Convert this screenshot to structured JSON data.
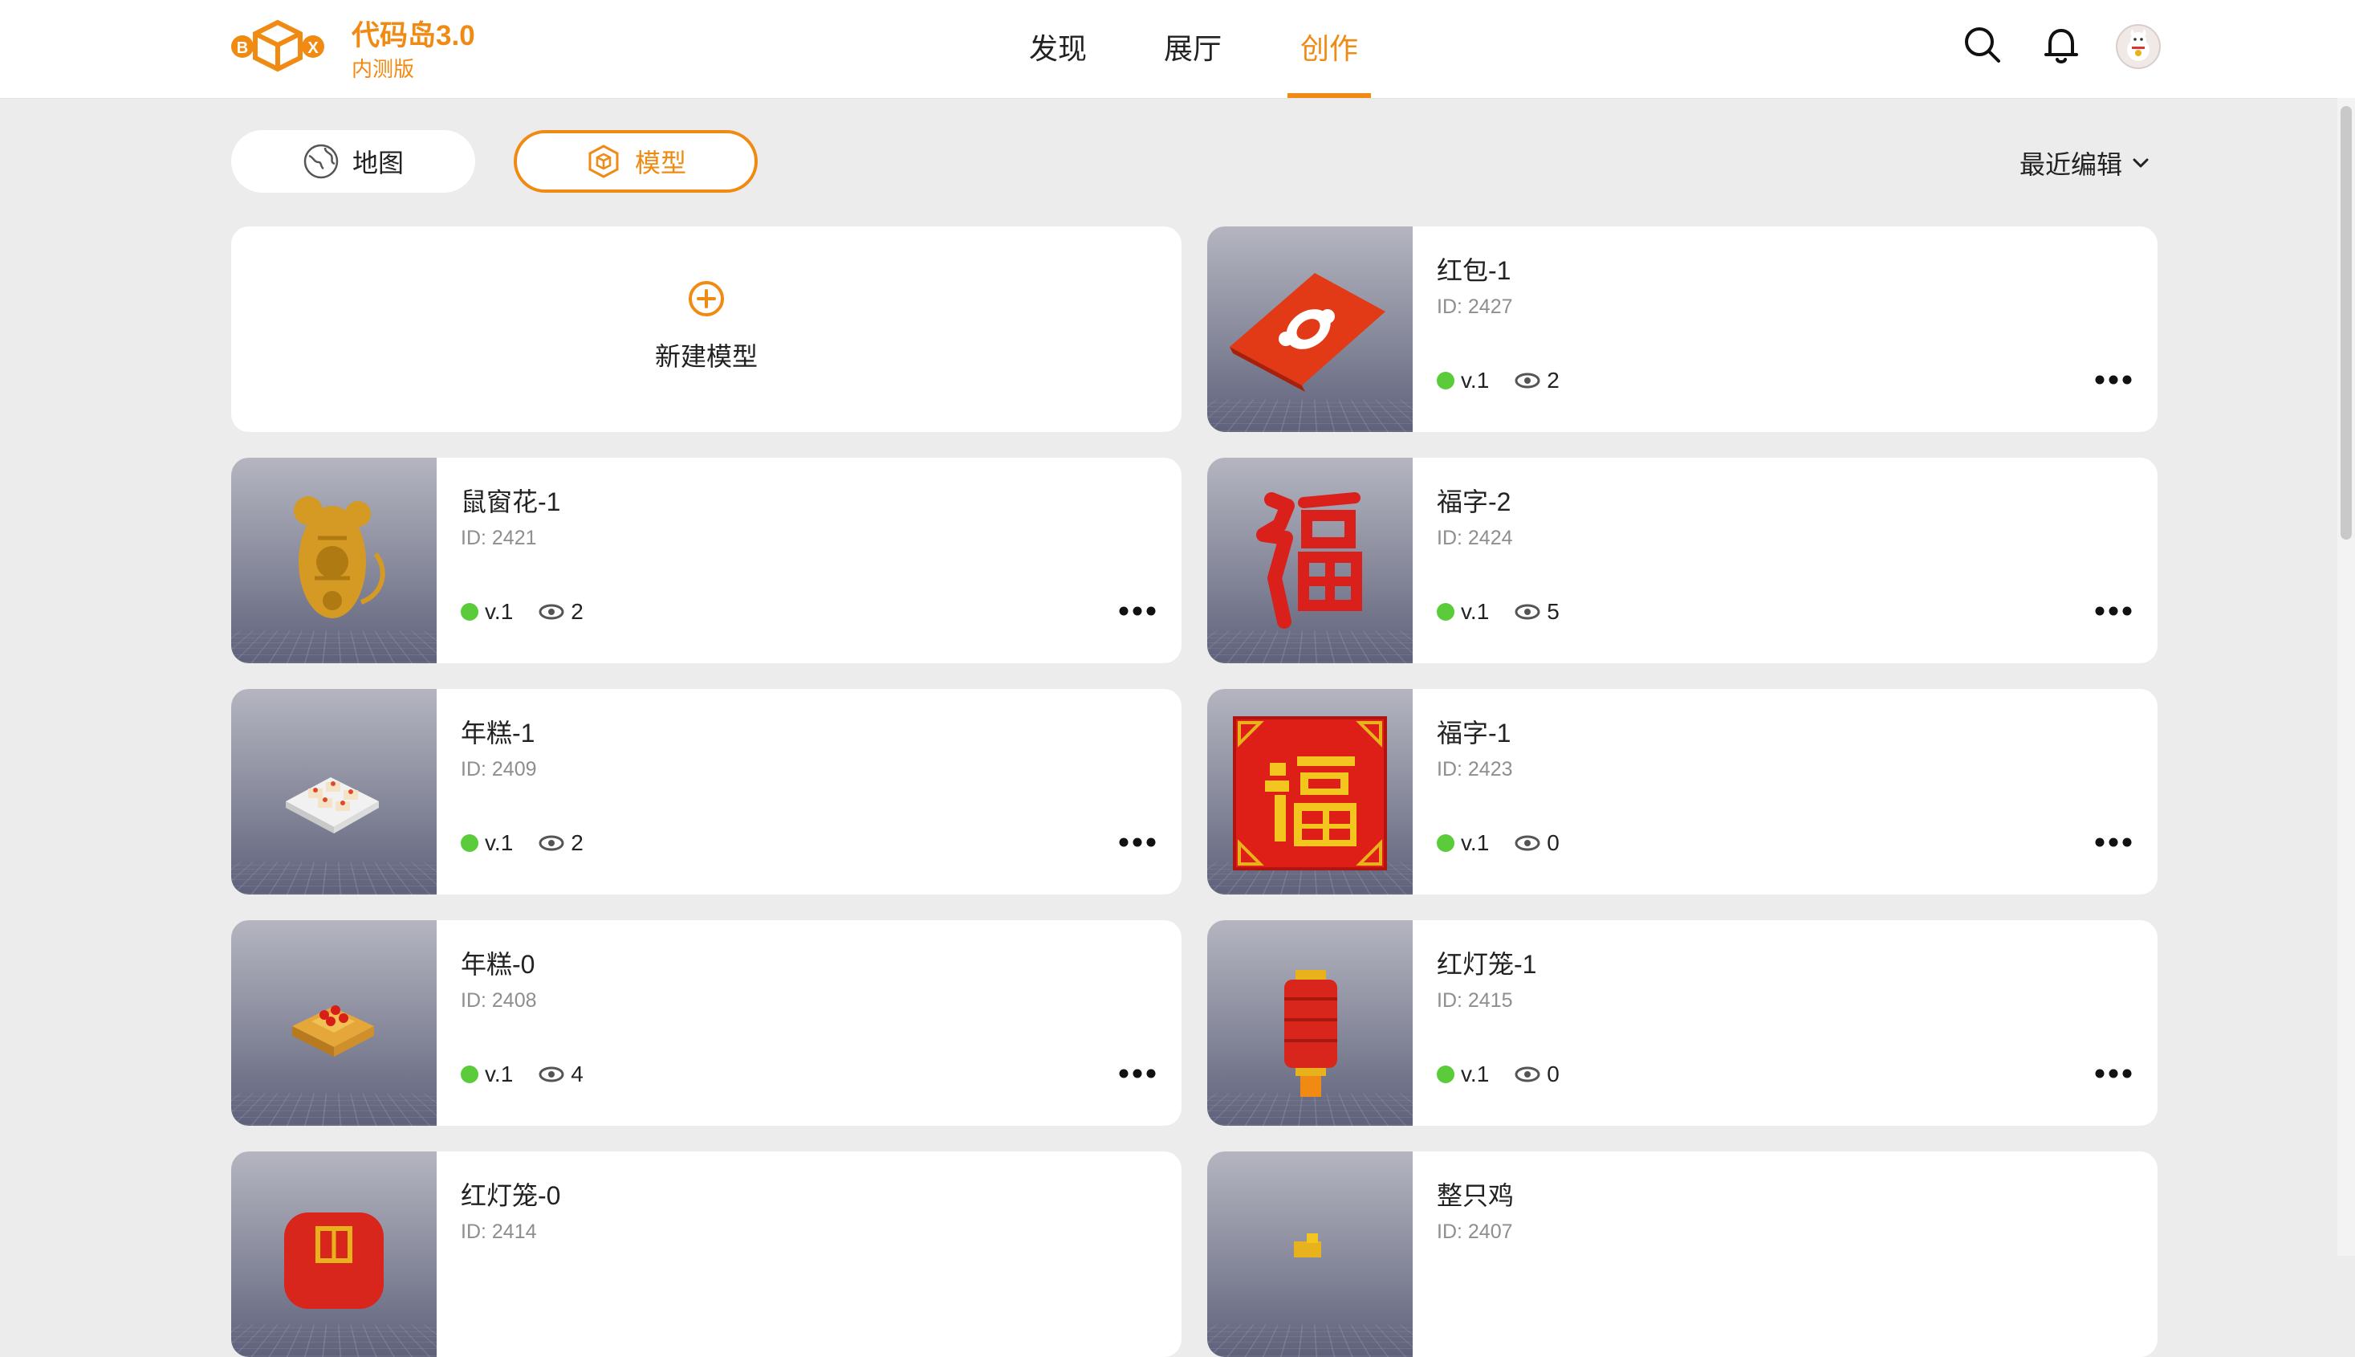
{
  "header": {
    "brand_title": "代码岛3.0",
    "brand_subtitle": "内测版",
    "nav": [
      {
        "label": "发现"
      },
      {
        "label": "展厅"
      },
      {
        "label": "创作",
        "active": true
      }
    ],
    "logo_letters": [
      "B",
      "X"
    ]
  },
  "filters": {
    "map_label": "地图",
    "model_label": "模型",
    "active": "模型",
    "sort_label": "最近编辑"
  },
  "new_card": {
    "label": "新建模型"
  },
  "cards": [
    {
      "title": "红包-1",
      "id": "ID: 2427",
      "version": "v.1",
      "views": "2",
      "thumb": "red-envelope"
    },
    {
      "title": "鼠窗花-1",
      "id": "ID: 2421",
      "version": "v.1",
      "views": "2",
      "thumb": "rat-paper-cut"
    },
    {
      "title": "福字-2",
      "id": "ID: 2424",
      "version": "v.1",
      "views": "5",
      "thumb": "fu-calligraphy"
    },
    {
      "title": "年糕-1",
      "id": "ID: 2409",
      "version": "v.1",
      "views": "2",
      "thumb": "rice-cake-plate"
    },
    {
      "title": "福字-1",
      "id": "ID: 2423",
      "version": "v.1",
      "views": "0",
      "thumb": "fu-square"
    },
    {
      "title": "年糕-0",
      "id": "ID: 2408",
      "version": "v.1",
      "views": "4",
      "thumb": "rice-cake-stack"
    },
    {
      "title": "红灯笼-1",
      "id": "ID: 2415",
      "version": "v.1",
      "views": "0",
      "thumb": "red-lantern"
    },
    {
      "title": "红灯笼-0",
      "id": "ID: 2414",
      "version": "",
      "views": "",
      "thumb": "red-lantern-round"
    },
    {
      "title": "整只鸡",
      "id": "ID: 2407",
      "version": "",
      "views": "",
      "thumb": "whole-chicken"
    }
  ],
  "colors": {
    "accent": "#f08a12",
    "published": "#5ccb3a",
    "background": "#ececec"
  }
}
